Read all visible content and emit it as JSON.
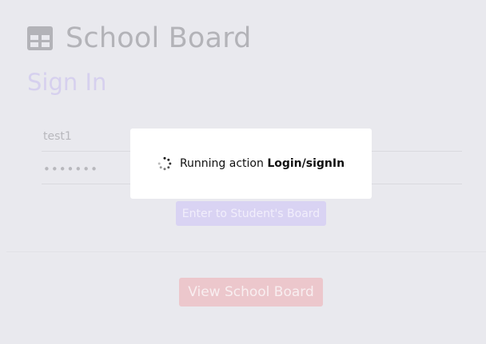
{
  "header": {
    "title": "School Board",
    "icon": "table-icon"
  },
  "signin": {
    "title": "Sign In",
    "username_value": "test1",
    "password_mask": "•••••••",
    "enter_button": "Enter to Student's Board"
  },
  "footer": {
    "view_button": "View School Board"
  },
  "modal": {
    "prefix": "Running action ",
    "action": "Login/signIn",
    "icon": "spinner-icon"
  },
  "colors": {
    "page_bg": "#e9e9ee",
    "accent_purple": "#d9d3f3",
    "accent_red": "#ecc7cc",
    "modal_bg": "#ffffff"
  }
}
